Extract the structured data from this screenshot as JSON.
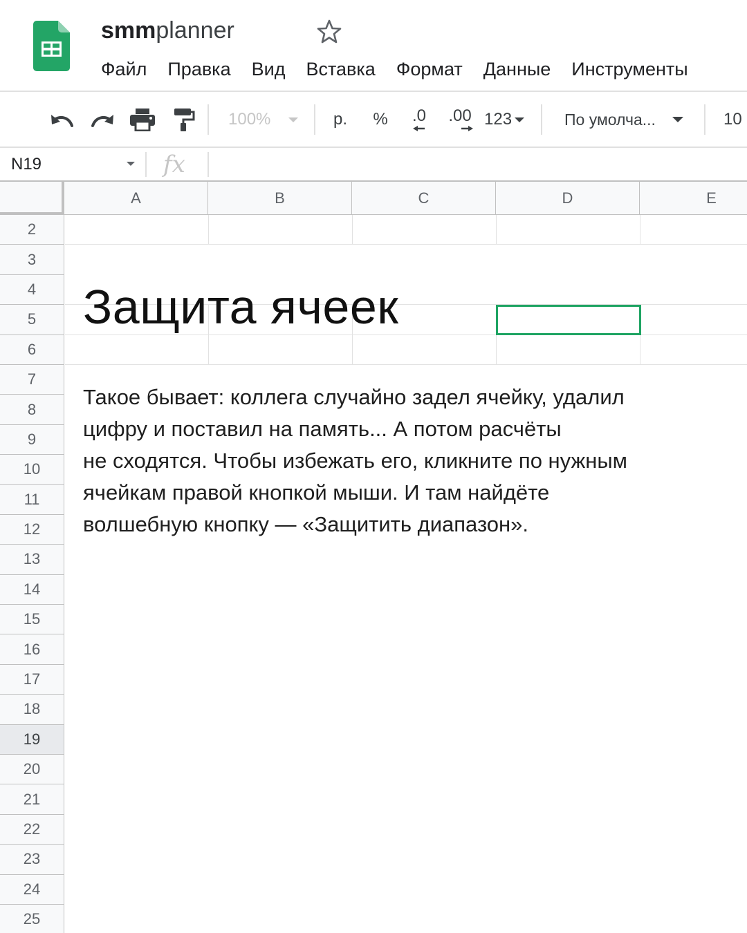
{
  "app": {
    "title_bold": "smm",
    "title_light": "planner",
    "menu": [
      "Файл",
      "Правка",
      "Вид",
      "Вставка",
      "Формат",
      "Данные",
      "Инструменты"
    ]
  },
  "toolbar": {
    "zoom": "100%",
    "currency": "р.",
    "percent": "%",
    "decrease_decimals": ".0",
    "increase_decimals": ".00",
    "more_formats": "123",
    "font": "По умолча...",
    "font_size": "10"
  },
  "formula_bar": {
    "cell_ref": "N19",
    "fx_label": "fx",
    "value": ""
  },
  "grid": {
    "columns": [
      "A",
      "B",
      "C",
      "D",
      "E"
    ],
    "rows": [
      "2",
      "3",
      "4",
      "5",
      "6",
      "7",
      "8",
      "9",
      "10",
      "11",
      "12",
      "13",
      "14",
      "15",
      "16",
      "17",
      "18",
      "19",
      "20",
      "21",
      "22",
      "23",
      "24",
      "25"
    ],
    "active_row": "19"
  },
  "content": {
    "heading": "Защита ячеек",
    "lines": [
      "Такое бывает: коллега случайно задел ячейку, удалил",
      "цифру и поставил на память... А потом расчёты",
      "не сходятся. Чтобы избежать его, кликните по нужным",
      "ячейкам правой кнопкой мыши. И там найдёте",
      "волшебную кнопку — «Защитить диапазон»."
    ]
  },
  "colors": {
    "logo_green": "#23a566",
    "selection": "#1fa463"
  }
}
